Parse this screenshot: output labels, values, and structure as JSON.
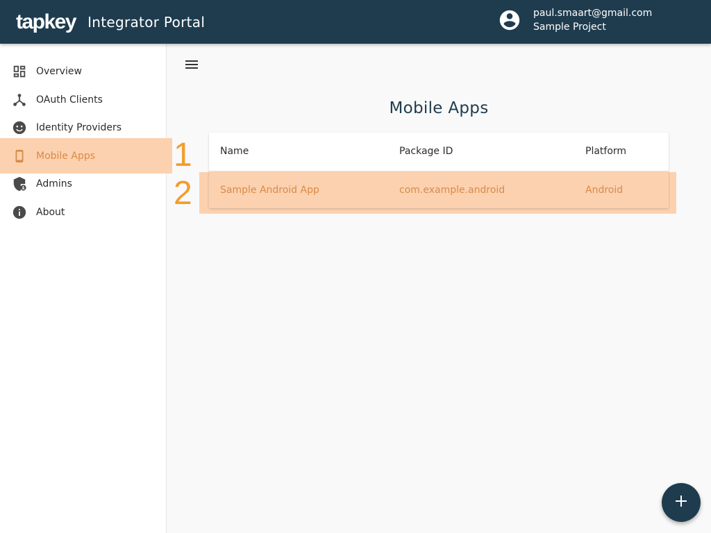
{
  "header": {
    "logo": "tapkey",
    "app_title": "Integrator Portal",
    "account_email": "paul.smaart@gmail.com",
    "account_project": "Sample Project"
  },
  "sidebar": {
    "items": [
      {
        "label": "Overview",
        "icon": "dashboard-icon"
      },
      {
        "label": "OAuth Clients",
        "icon": "hub-icon"
      },
      {
        "label": "Identity Providers",
        "icon": "face-icon"
      },
      {
        "label": "Mobile Apps",
        "icon": "smartphone-icon",
        "active": true
      },
      {
        "label": "Admins",
        "icon": "admin-shield-icon"
      },
      {
        "label": "About",
        "icon": "info-icon"
      }
    ]
  },
  "main": {
    "title": "Mobile Apps",
    "table": {
      "columns": [
        "Name",
        "Package ID",
        "Platform"
      ],
      "rows": [
        [
          "Sample Android App",
          "com.example.android",
          "Android"
        ]
      ]
    }
  },
  "annotations": [
    "1",
    "2"
  ],
  "fab_icon": "plus-icon",
  "colors": {
    "header_bg": "#1f3c4f",
    "accent": "#d98a48",
    "highlight": "#fcd1af",
    "annotation": "#f39c2b"
  }
}
